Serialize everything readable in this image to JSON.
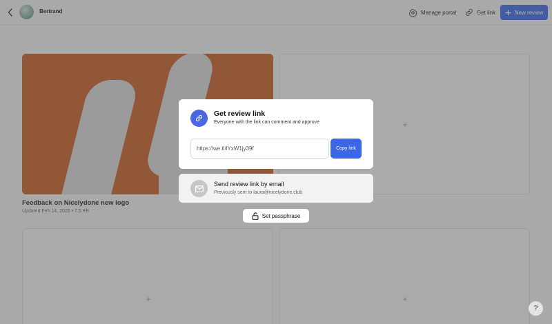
{
  "header": {
    "username": "Bertrand",
    "manage_portal": "Manage portal",
    "get_link": "Get link",
    "new_review": "New review"
  },
  "project": {
    "title": "Feedback on Nicelydone new logo",
    "meta": "Updated Feb 14, 2025 • 7.5 KB"
  },
  "empty_card_icon": "+",
  "modal": {
    "title": "Get review link",
    "subtitle": "Everyone with the link can comment and approve",
    "url": "https://we.tl/lYxW1jy39f",
    "copy_label": "Copy link"
  },
  "email_option": {
    "title": "Send review link by email",
    "subtitle": "Previously sent to laura@nicelydone.club"
  },
  "passphrase_label": "Set passphrase",
  "help_label": "?",
  "colors": {
    "accent": "#3b66e6",
    "thumbnail": "#c95e23"
  },
  "icons": [
    "chevron-left-icon",
    "gear-icon",
    "link-icon",
    "plus-icon",
    "mail-icon",
    "lock-icon"
  ]
}
